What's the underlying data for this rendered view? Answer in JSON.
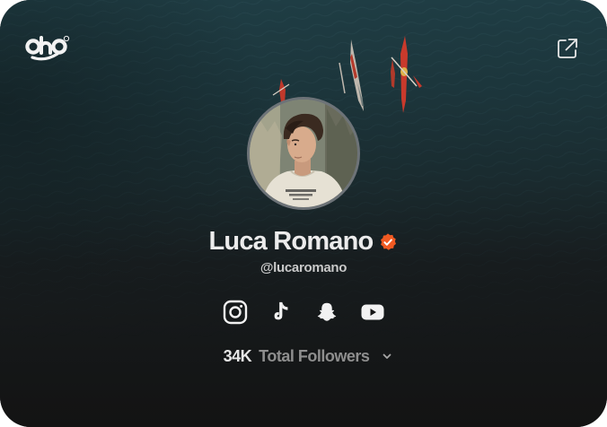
{
  "profile": {
    "name": "Luca Romano",
    "handle": "@lucaromano",
    "verified": true,
    "avatar": "profile-photo"
  },
  "brand": {
    "logo_text": "oho",
    "logo_icon": "oho-logo-icon"
  },
  "header": {
    "share_icon": "external-link-icon"
  },
  "socials": [
    {
      "platform": "Instagram",
      "icon": "instagram-icon"
    },
    {
      "platform": "TikTok",
      "icon": "tiktok-icon"
    },
    {
      "platform": "Snapchat",
      "icon": "snapchat-icon"
    },
    {
      "platform": "YouTube",
      "icon": "youtube-icon"
    }
  ],
  "stats": {
    "followers_count": "34K",
    "followers_label": "Total Followers",
    "dropdown_icon": "chevron-down-icon"
  },
  "colors": {
    "verified_badge": "#f15a22",
    "text_primary": "#ececec",
    "text_secondary": "#8e8e8e",
    "background_dark": "#141414",
    "water": "#1d3a40"
  }
}
